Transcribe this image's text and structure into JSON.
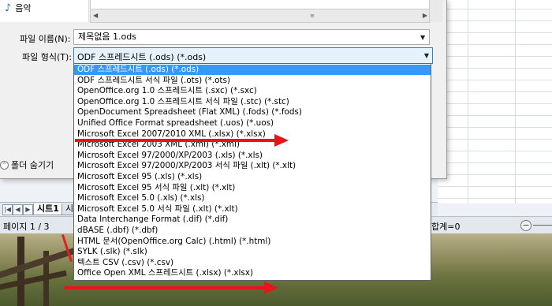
{
  "places": {
    "music_label": "음악"
  },
  "dialog": {
    "filename_label": "파일 이름(N):",
    "filename_value": "제목없음 1.ods",
    "filetype_label": "파일 형식(T):",
    "filetype_value": "ODF 스프레드시트 (.ods) (*.ods)",
    "folder_toggle_label": "폴더 숨기기"
  },
  "filetypes": [
    "ODF 스프레드시트 (.ods) (*.ods)",
    "ODF 스프레드시트 서식 파일 (.ots) (*.ots)",
    "OpenOffice.org 1.0 스프레드시트 (.sxc) (*.sxc)",
    "OpenOffice.org 1.0 스프레드시트 서식 파일 (.stc) (*.stc)",
    "OpenDocument Spreadsheet (Flat XML) (.fods) (*.fods)",
    "Unified Office Format spreadsheet (.uos) (*.uos)",
    "Microsoft Excel 2007/2010 XML (.xlsx) (*.xlsx)",
    "Microsoft Excel 2003 XML (.xml) (*.xml)",
    "Microsoft Excel 97/2000/XP/2003 (.xls) (*.xls)",
    "Microsoft Excel 97/2000/XP/2003 서식 파일 (.xlt) (*.xlt)",
    "Microsoft Excel 95 (.xls) (*.xls)",
    "Microsoft Excel 95 서식 파일 (.xlt) (*.xlt)",
    "Microsoft Excel 5.0 (.xls) (*.xls)",
    "Microsoft Excel 5.0 서식 파일 (.xlt) (*.xlt)",
    "Data Interchange Format (.dif) (*.dif)",
    "dBASE (.dbf) (*.dbf)",
    "HTML 문서(OpenOffice.org Calc) (.html) (*.html)",
    "SYLK (.slk) (*.slk)",
    "텍스트 CSV (.csv) (*.csv)",
    "Office Open XML 스프레드시트 (.xlsx) (*.xlsx)"
  ],
  "selected_filetype_index": 0,
  "sheet": {
    "tab1": "시트1",
    "tab2": "시"
  },
  "status": {
    "page": "페이지 1 / 3",
    "sum": "합계=0"
  },
  "colors": {
    "highlight": "#3399ff",
    "annotation_arrow": "#e8141a"
  }
}
